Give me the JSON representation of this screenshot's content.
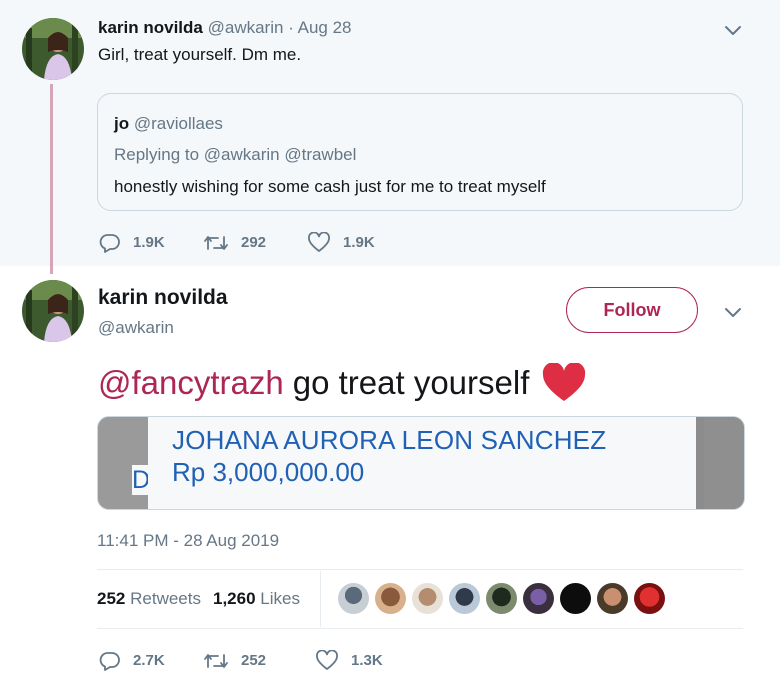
{
  "parent_tweet": {
    "author_name": "karin novilda",
    "author_handle": "@awkarin",
    "date": "· Aug 28",
    "text": "Girl, treat yourself. Dm me.",
    "quoted": {
      "author_name": "jo",
      "author_handle": "@raviollaes",
      "replying_to": "Replying to @awkarin @trawbel",
      "text": "honestly wishing for some cash just for me to treat myself"
    },
    "actions": {
      "replies": "1.9K",
      "retweets": "292",
      "likes": "1.9K"
    }
  },
  "main_tweet": {
    "author_name": "karin novilda",
    "author_handle": "@awkarin",
    "follow_label": "Follow",
    "mention": "@fancytrazh",
    "text": "go treat yourself",
    "media": {
      "partial_letter": "D",
      "recipient": "JOHANA AURORA LEON SANCHEZ",
      "amount": "Rp 3,000,000.00"
    },
    "timestamp": "11:41 PM - 28 Aug 2019",
    "stats": {
      "retweets_count": "252",
      "retweets_label": "Retweets",
      "likes_count": "1,260",
      "likes_label": "Likes"
    },
    "actions": {
      "replies": "2.7K",
      "retweets": "252",
      "likes": "1.3K"
    }
  },
  "icons": {
    "reply": "reply-icon",
    "retweet": "retweet-icon",
    "like": "heart-outline-icon",
    "chevron": "chevron-down-icon",
    "emoji": "red-heart-emoji"
  },
  "colors": {
    "accent": "#ad2752",
    "muted": "#657786",
    "link_blue": "#2061b5",
    "thread_line": "#d7a6b6",
    "parent_bg": "#f5f8fa"
  }
}
